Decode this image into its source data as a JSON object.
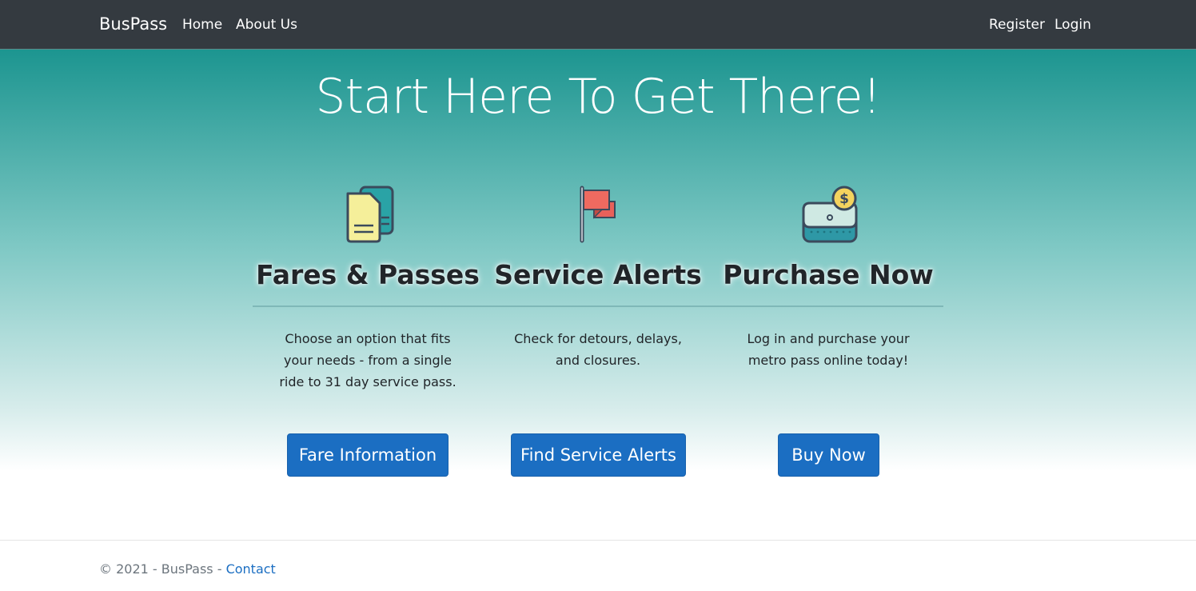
{
  "navbar": {
    "brand": "BusPass",
    "links": [
      {
        "label": "Home"
      },
      {
        "label": "About Us"
      }
    ],
    "right_links": [
      {
        "label": "Register"
      },
      {
        "label": "Login"
      }
    ]
  },
  "hero": {
    "title": "Start Here To Get There!"
  },
  "columns": [
    {
      "icon": "documents-icon",
      "heading": "Fares & Passes",
      "text": "Choose an option that fits your needs - from a single ride to 31 day service pass.",
      "button": "Fare Information"
    },
    {
      "icon": "flag-icon",
      "heading": "Service Alerts",
      "text": "Check for detours, delays, and closures.",
      "button": "Find Service Alerts"
    },
    {
      "icon": "wallet-icon",
      "heading": "Purchase Now",
      "text": "Log in and purchase your metro pass online today!",
      "button": "Buy Now"
    }
  ],
  "footer": {
    "text": "© 2021 - BusPass - ",
    "contact": "Contact"
  },
  "colors": {
    "navbar": "#343a40",
    "hero_top": "#1c9590",
    "button": "#1b6ec2"
  }
}
